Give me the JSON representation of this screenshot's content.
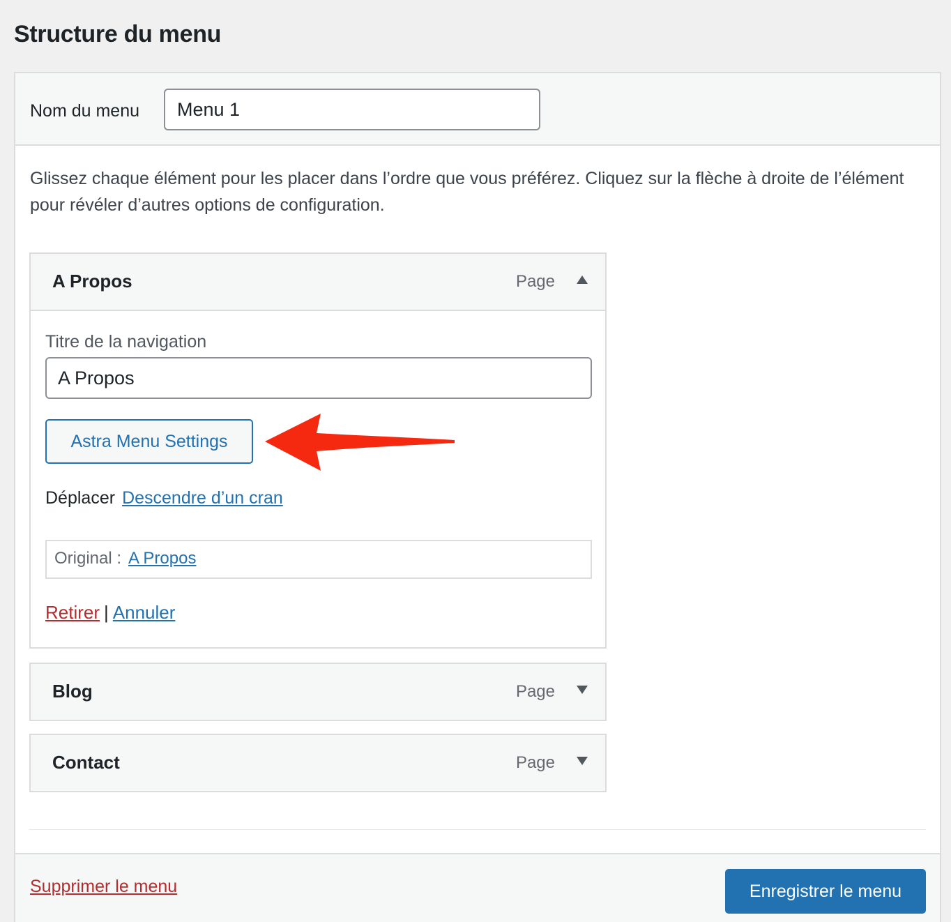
{
  "page_title": "Structure du menu",
  "menu_name": {
    "label": "Nom du menu",
    "value": "Menu 1"
  },
  "instructions": "Glissez chaque élément pour les placer dans l’ordre que vous préférez. Cliquez sur la flèche à droite de l’élément pour révéler d’autres options de configuration.",
  "items": [
    {
      "title": "A Propos",
      "type": "Page",
      "expanded": true,
      "arrow_icon": "triangle-up-icon",
      "settings": {
        "nav_label": "Titre de la navigation",
        "nav_value": "A Propos",
        "astra_button": "Astra Menu Settings",
        "move_label": "Déplacer",
        "move_link": "Descendre d’un cran",
        "original_label": "Original :",
        "original_link": "A Propos",
        "remove_link": "Retirer",
        "separator": "|",
        "cancel_link": "Annuler"
      }
    },
    {
      "title": "Blog",
      "type": "Page",
      "expanded": false,
      "arrow_icon": "triangle-down-icon"
    },
    {
      "title": "Contact",
      "type": "Page",
      "expanded": false,
      "arrow_icon": "triangle-down-icon"
    }
  ],
  "footer": {
    "delete_link": "Supprimer le menu",
    "save_button": "Enregistrer le menu"
  },
  "colors": {
    "accent": "#2271b1",
    "danger": "#b32d2e",
    "annotation_arrow": "#f5290f",
    "background": "#f0f0f1"
  }
}
